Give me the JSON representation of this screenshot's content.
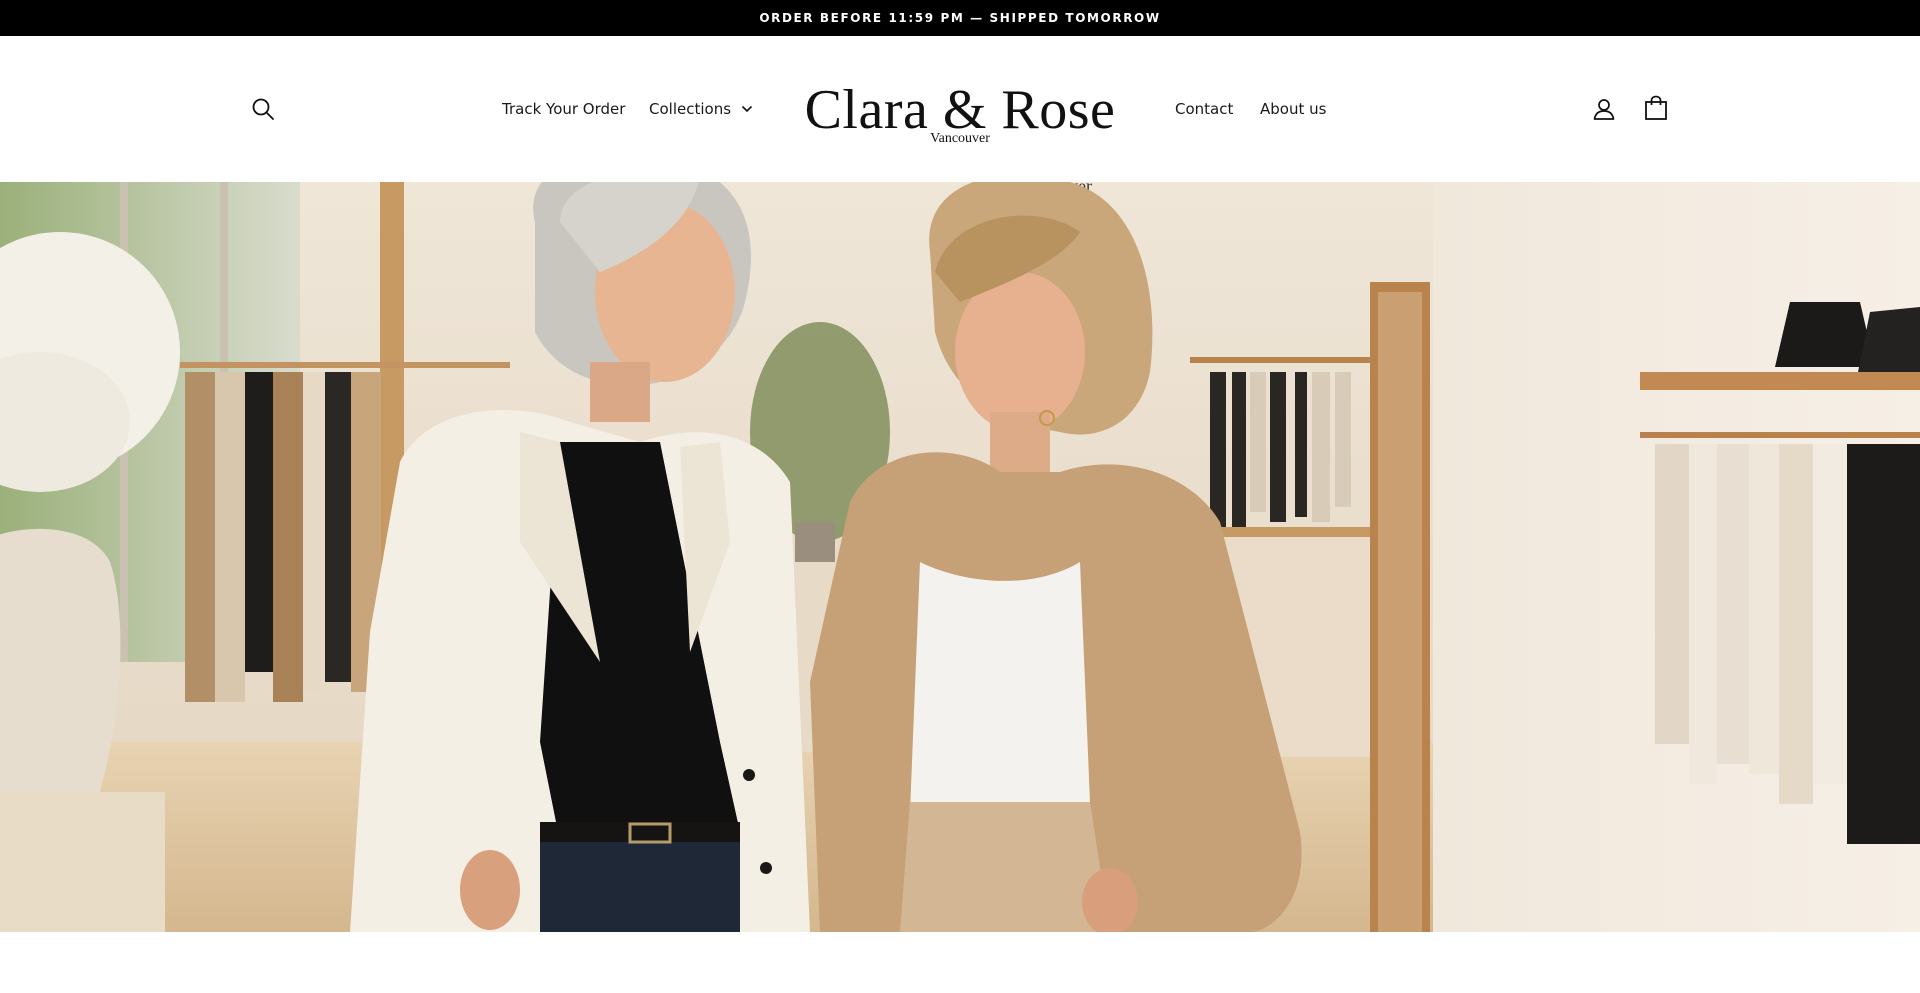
{
  "announcement": {
    "text": "ORDER BEFORE 11:59 PM — SHIPPED TOMORROW"
  },
  "header": {
    "logo": {
      "name": "Clara & Rose",
      "location": "Vancouver"
    },
    "nav_left": [
      {
        "label": "Track Your Order"
      },
      {
        "label": "Collections",
        "has_dropdown": true
      }
    ],
    "nav_right": [
      {
        "label": "Contact"
      },
      {
        "label": "About us"
      }
    ],
    "icons": {
      "search": "search-icon",
      "account": "account-icon",
      "cart": "shopping-bag-icon"
    }
  },
  "hero": {
    "image": "hero-image",
    "wall_sign": "Vancouver"
  },
  "colors": {
    "announcement_bg": "#000000",
    "announcement_text": "#ffffff",
    "header_bg": "#ffffff",
    "text": "#1a1a1a"
  }
}
